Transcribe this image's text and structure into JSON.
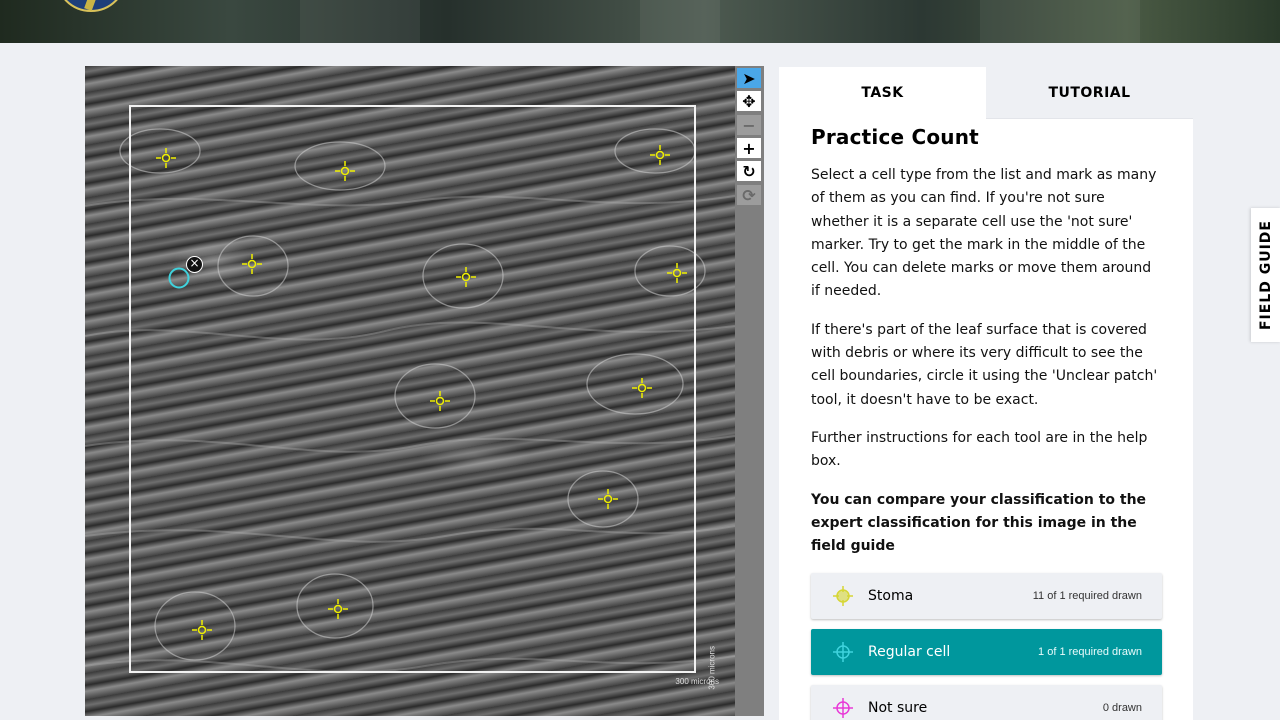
{
  "viewer": {
    "scale_label": "300 microns",
    "scale_label_vertical": "300 microns",
    "stoma_marker_count": 11,
    "regular_cell_marker_count": 1
  },
  "toolbar": {
    "tools": [
      {
        "name": "annotate",
        "icon": "pointer-icon",
        "glyph": "➤"
      },
      {
        "name": "move",
        "icon": "move-icon",
        "glyph": "✥"
      },
      {
        "name": "zoom-out",
        "icon": "minus-icon",
        "glyph": "−"
      },
      {
        "name": "zoom-in",
        "icon": "plus-icon",
        "glyph": "+"
      },
      {
        "name": "rotate",
        "icon": "rotate-icon",
        "glyph": "↻"
      },
      {
        "name": "reset",
        "icon": "reset-icon",
        "glyph": "⟳"
      }
    ]
  },
  "task": {
    "tabs": [
      {
        "label": "TASK"
      },
      {
        "label": "TUTORIAL"
      }
    ],
    "title": "Practice Count",
    "paragraphs": [
      "Select a cell type from the list and mark as many of them as you can find. If you're not sure whether it is a separate cell use the 'not sure' marker. Try to get the mark in the middle of the cell. You can delete marks or move them around if needed.",
      "If there's part of the leaf surface that is covered with debris or where its very difficult to see the cell boundaries, circle it using the 'Unclear patch' tool, it doesn't have to be exact.",
      "Further instructions for each tool are in the help box."
    ],
    "bold_paragraph": "You can compare your classification to the expert classification for this image in the field guide",
    "tools": [
      {
        "label": "Stoma",
        "count": "11 of 1 required drawn",
        "color": "#d6d635",
        "icon": "stoma-crosshair-icon"
      },
      {
        "label": "Regular cell",
        "count": "1 of 1 required drawn",
        "color": "#3fd3dd",
        "icon": "regular-cell-crosshair-icon"
      },
      {
        "label": "Not sure",
        "count": "0 drawn",
        "color": "#e83ad7",
        "icon": "not-sure-crosshair-icon"
      }
    ]
  },
  "field_guide": {
    "label": "FIELD GUIDE"
  },
  "colors": {
    "accent": "#00979d",
    "stoma": "#f0f000",
    "regular_cell": "#3fd3dd",
    "not_sure": "#e83ad7",
    "active_tool": "#4aa7e8"
  }
}
